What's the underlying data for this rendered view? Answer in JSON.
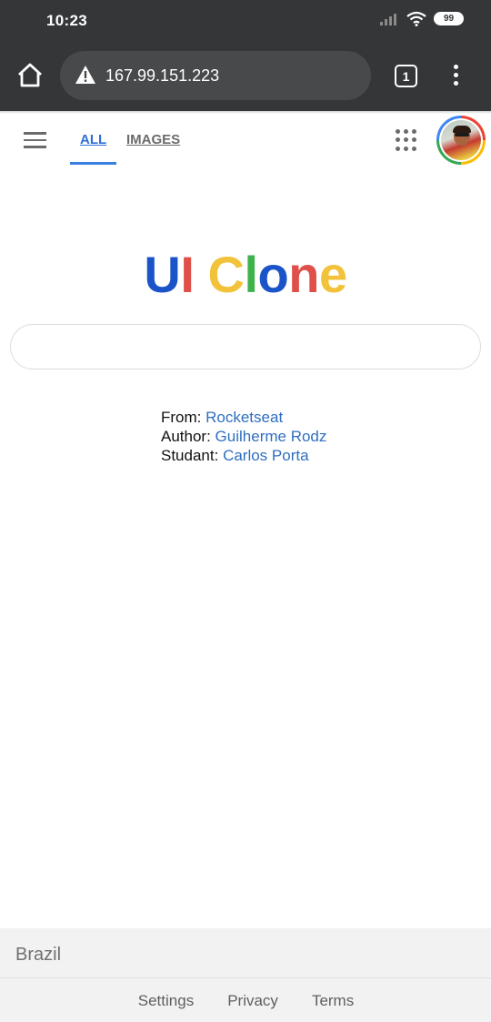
{
  "status_bar": {
    "time": "10:23",
    "battery": "99",
    "icons": [
      "signal-icon",
      "wifi-icon",
      "battery-icon"
    ]
  },
  "browser": {
    "url": "167.99.151.223",
    "tab_count": "1",
    "icons": [
      "home-icon",
      "warning-icon",
      "tabs-icon",
      "overflow-menu-icon"
    ]
  },
  "header": {
    "tabs": [
      {
        "label": "ALL",
        "active": true
      },
      {
        "label": "IMAGES",
        "active": false
      }
    ],
    "icons": [
      "hamburger-menu-icon",
      "apps-grid-icon",
      "avatar"
    ]
  },
  "logo": {
    "letters": [
      {
        "char": "U",
        "color": "#1a54c8"
      },
      {
        "char": "I",
        "color": "#e0504a"
      },
      {
        "char": " ",
        "color": "#000000"
      },
      {
        "char": "C",
        "color": "#f3c23b"
      },
      {
        "char": "l",
        "color": "#3db14a"
      },
      {
        "char": "o",
        "color": "#1a54c8"
      },
      {
        "char": "n",
        "color": "#e0504a"
      },
      {
        "char": "e",
        "color": "#f3c23b"
      }
    ]
  },
  "search": {
    "value": "",
    "placeholder": ""
  },
  "credits": {
    "from_label": "From:",
    "from_value": "Rocketseat",
    "author_label": "Author:",
    "author_value": "Guilherme Rodz",
    "student_label": "Studant:",
    "student_value": "Carlos Porta"
  },
  "footer": {
    "country": "Brazil",
    "links": [
      "Settings",
      "Privacy",
      "Terms"
    ]
  },
  "colors": {
    "browser_chrome": "#353638",
    "link_blue": "#2f6fbf",
    "tab_active": "#2f6fd4"
  }
}
